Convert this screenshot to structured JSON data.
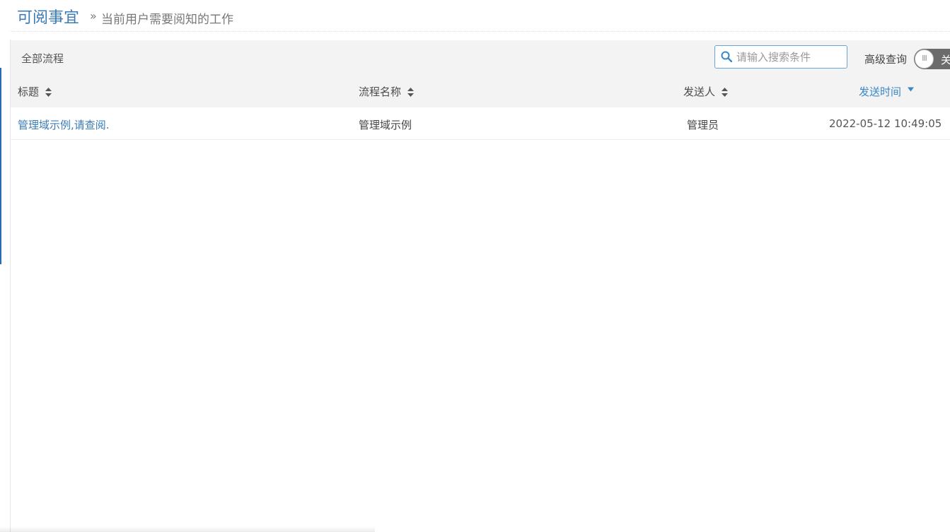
{
  "header": {
    "title": "可阅事宜",
    "separator": "»",
    "subtitle": "当前用户需要阅知的工作"
  },
  "toolbar": {
    "filter_label": "全部流程",
    "search": {
      "placeholder": "请输入搜索条件",
      "value": "",
      "icon": "search-icon"
    },
    "advanced_label": "高级查询",
    "advanced_toggle": {
      "state": "off",
      "text": "关"
    }
  },
  "table": {
    "columns": [
      {
        "label": "标题",
        "sort": "none"
      },
      {
        "label": "流程名称",
        "sort": "none"
      },
      {
        "label": "发送人",
        "sort": "none"
      },
      {
        "label": "发送时间",
        "sort": "desc"
      }
    ],
    "rows": [
      {
        "title": "管理域示例,请查阅.",
        "process": "管理域示例",
        "sender": "管理员",
        "time": "2022-05-12 10:49:05"
      }
    ]
  },
  "colors": {
    "accent": "#3a7bb5",
    "active_sort": "#3a87c8",
    "toolbar_bg": "#f3f3f3",
    "toggle_bg": "#6b6b6b"
  }
}
